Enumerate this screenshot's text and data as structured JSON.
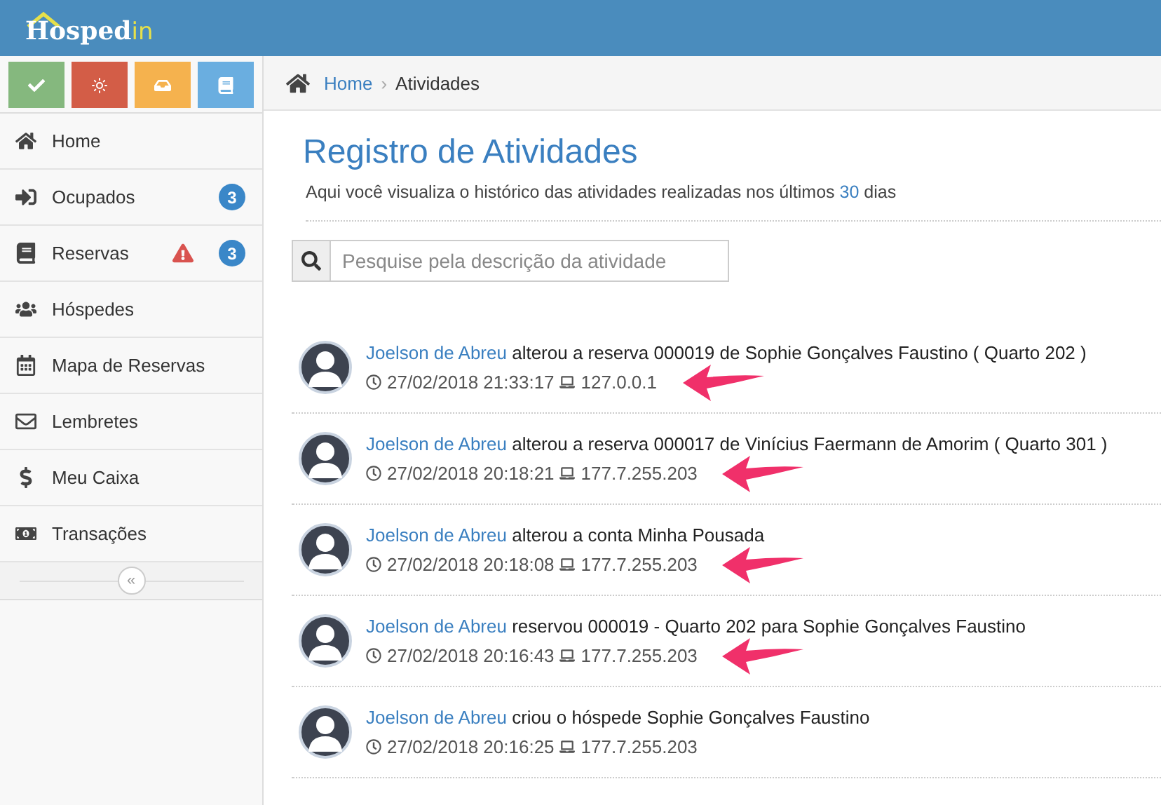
{
  "header": {
    "logo_main": "Hosped",
    "logo_accent": "in"
  },
  "quick_buttons": [
    {
      "color": "#85b87e"
    },
    {
      "color": "#d35d47"
    },
    {
      "color": "#f5b24e"
    },
    {
      "color": "#6aaee0"
    }
  ],
  "sidebar": {
    "items": [
      {
        "label": "Home",
        "alert": false
      },
      {
        "label": "Ocupados",
        "badge": "3",
        "alert": false
      },
      {
        "label": "Reservas",
        "badge": "3",
        "alert": true
      },
      {
        "label": "Hóspedes",
        "alert": false
      },
      {
        "label": "Mapa de Reservas",
        "alert": false
      },
      {
        "label": "Lembretes",
        "alert": false
      },
      {
        "label": "Meu Caixa",
        "alert": false
      },
      {
        "label": "Transações",
        "alert": false
      }
    ],
    "collapse": "«"
  },
  "breadcrumb_separator": "›",
  "breadcrumb": [
    {
      "label": "Home",
      "link": true
    },
    {
      "label": "Atividades",
      "link": false
    }
  ],
  "page": {
    "title": "Registro de Atividades",
    "subtitle_before": "Aqui você visualiza o histórico das atividades realizadas nos últimos",
    "subtitle_number": "30",
    "subtitle_after": "dias"
  },
  "search": {
    "placeholder": "Pesquise pela descrição da atividade"
  },
  "activities": [
    {
      "actor": "Joelson de Abreu",
      "action": "alterou a reserva 000019 de Sophie Gonçalves Faustino ( Quarto 202 )",
      "time": "27/02/2018 21:33:17",
      "ip": "127.0.0.1",
      "pointed": true
    },
    {
      "actor": "Joelson de Abreu",
      "action": "alterou a reserva 000017 de Vinícius Faermann de Amorim ( Quarto 301 )",
      "time": "27/02/2018 20:18:21",
      "ip": "177.7.255.203",
      "pointed": true
    },
    {
      "actor": "Joelson de Abreu",
      "action": "alterou a conta Minha Pousada",
      "time": "27/02/2018 20:18:08",
      "ip": "177.7.255.203",
      "pointed": true
    },
    {
      "actor": "Joelson de Abreu",
      "action": "reservou 000019 - Quarto 202 para Sophie Gonçalves Faustino",
      "time": "27/02/2018 20:16:43",
      "ip": "177.7.255.203",
      "pointed": true
    },
    {
      "actor": "Joelson de Abreu",
      "action": "criou o hóspede Sophie Gonçalves Faustino",
      "time": "27/02/2018 20:16:25",
      "ip": "177.7.255.203",
      "pointed": false
    }
  ]
}
